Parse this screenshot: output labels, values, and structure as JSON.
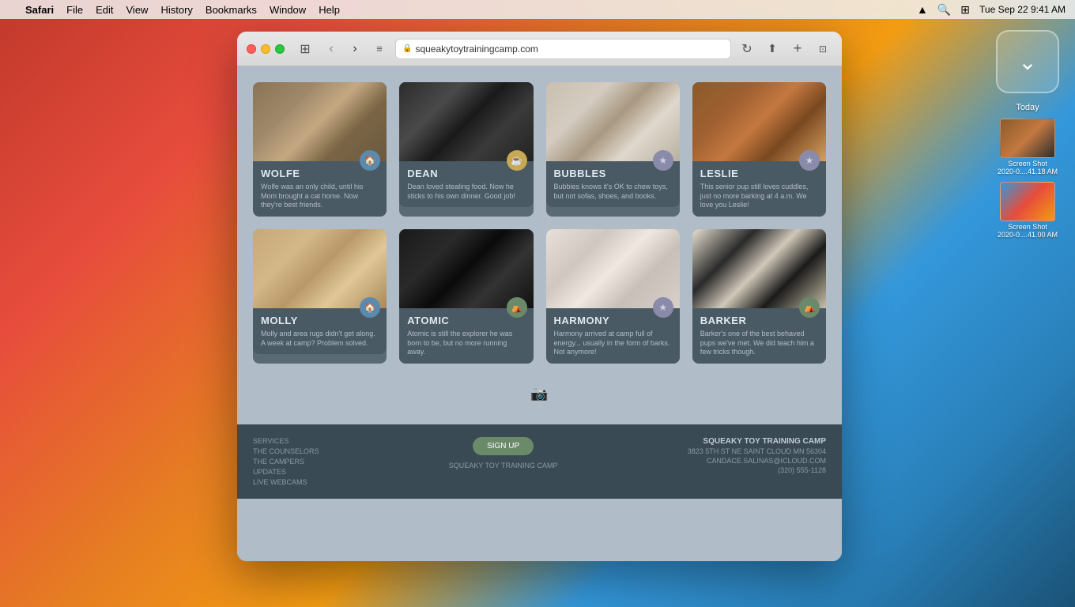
{
  "menubar": {
    "apple": "⌘",
    "app": "Safari",
    "menus": [
      "File",
      "Edit",
      "View",
      "History",
      "Bookmarks",
      "Window",
      "Help"
    ],
    "time": "Tue Sep 22  9:41 AM"
  },
  "browser": {
    "url": "squeakytoytrainingcamp.com",
    "reload_label": "⟳"
  },
  "desktop": {
    "today_label": "Today",
    "chevron": "⌄",
    "screenshots": [
      {
        "label": "Screen Shot\n2020-0....41.18 AM"
      },
      {
        "label": "Screen Shot\n2020-0....41.00 AM"
      }
    ]
  },
  "website": {
    "dogs": [
      {
        "name": "WOLFE",
        "desc": "Wolfe was an only child, until his Mom brought a cat home. Now they're best friends.",
        "badge_type": "house",
        "badge_symbol": "🏠"
      },
      {
        "name": "DEAN",
        "desc": "Dean loved stealing food. Now he sticks to his own dinner. Good job!",
        "badge_type": "cup",
        "badge_symbol": "☕"
      },
      {
        "name": "BUBBLES",
        "desc": "Bubbies knows it's OK to chew toys, but not sofas, shoes, and books.",
        "badge_type": "star",
        "badge_symbol": "★"
      },
      {
        "name": "LESLIE",
        "desc": "This senior pup still loves cuddles, just no more barking at 4 a.m. We love you Leslie!",
        "badge_type": "star",
        "badge_symbol": "★"
      },
      {
        "name": "MOLLY",
        "desc": "Molly and area rugs didn't get along. A week at camp? Problem solved.",
        "badge_type": "house",
        "badge_symbol": "🏠"
      },
      {
        "name": "ATOMIC",
        "desc": "Atomic is still the explorer he was born to be, but no more running away.",
        "badge_type": "tent",
        "badge_symbol": "⛺"
      },
      {
        "name": "HARMONY",
        "desc": "Harmony arrived at camp full of energy... usually in the form of barks. Not anymore!",
        "badge_type": "star",
        "badge_symbol": "★"
      },
      {
        "name": "BARKER",
        "desc": "Barker's one of the best behaved pups we've met. We did teach him a few tricks though.",
        "badge_type": "tent",
        "badge_symbol": "⛺"
      }
    ],
    "footer": {
      "nav_links": [
        "SERVICES",
        "THE COUNSELORS",
        "THE CAMPERS",
        "UPDATES",
        "LIVE WEBCAMS"
      ],
      "signup_label": "SIGN UP",
      "brand": "SQUEAKY TOY TRAINING CAMP",
      "address": "3823 5TH ST NE SAINT CLOUD MN 56304",
      "email": "CANDACE.SALINAS@ICLOUD.COM",
      "phone": "(320) 555-1128",
      "brand_name": "SQUEAKY TOY TRAINING CAMP"
    }
  }
}
